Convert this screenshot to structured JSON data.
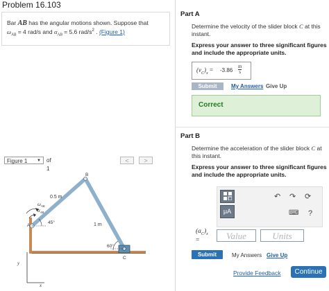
{
  "problem": {
    "title": "Problem 16.103",
    "intro": {
      "text_a": "Bar ",
      "bar": "AB",
      "text_b": " has the angular motions shown. Suppose that",
      "omega": "ω",
      "omega_sub": "AB",
      "omega_eq": " = 4  rad/s",
      "and": " and ",
      "alpha": "α",
      "alpha_sub": "AB",
      "alpha_eq": " = 5.6  rad/s",
      "alpha_exp": "2",
      "sep": " . ",
      "figure_link": "(Figure 1)"
    }
  },
  "figure_nav": {
    "select_value": "Figure 1",
    "of_label": "of 1",
    "prev": "<",
    "next": ">"
  },
  "figure": {
    "labels": {
      "b": "B",
      "c": "C",
      "a": "A",
      "omega": "ω",
      "omega_sub": "AB",
      "alpha": "α",
      "alpha_sub": "AB",
      "len1": "0.5 m",
      "len2": "1 m",
      "ang1": "45°",
      "ang2": "60°",
      "x": "x",
      "y": "y"
    }
  },
  "part_a": {
    "title": "Part A",
    "question_a": "Determine the velocity of the slider block ",
    "question_var": "C",
    "question_b": " at this instant.",
    "instruction": "Express your answer to three significant figures and include the appropriate units.",
    "answer_label": "(v",
    "answer_label_sub": "C",
    "answer_label_end": ")",
    "answer_label_x": "x",
    "answer_eq": " = ",
    "answer_value": "-3.86",
    "answer_unit_num": "m",
    "answer_unit_den": "s",
    "submit_tab": "Submit",
    "my_answers": "My Answers",
    "give_up": "Give Up",
    "result": "Correct"
  },
  "part_b": {
    "title": "Part B",
    "question_a": "Determine the acceleration of the slider block ",
    "question_var": "C",
    "question_b": " at this instant.",
    "instruction": "Express your answer to three significant figures and include the appropriate units.",
    "toolbar": {
      "mu_a": "μA",
      "undo": "↶",
      "redo": "↷",
      "reset": "⟳",
      "keyboard": "⌨",
      "help": "?"
    },
    "answer_label": "(a",
    "answer_label_sub": "C",
    "answer_label_end": ")",
    "answer_label_x": "x",
    "answer_eq": "=",
    "value_placeholder": "Value",
    "units_placeholder": "Units",
    "submit": "Submit",
    "my_answers": "My Answers",
    "give_up": "Give Up"
  },
  "footer": {
    "feedback": "Provide Feedback",
    "continue": "Continue"
  },
  "colors": {
    "accent": "#2a72b5",
    "correct_bg": "#dff0d8",
    "bar": "#9fb5c8",
    "ground": "#c58a55"
  }
}
